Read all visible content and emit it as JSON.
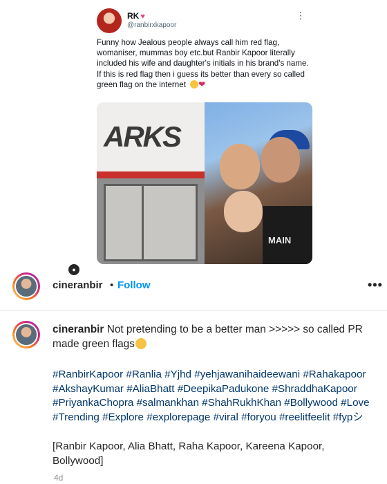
{
  "tweet": {
    "name": "RK",
    "handle": "@ranbirxkapoor",
    "more": "⋮",
    "text": "Funny how Jealous people always call him red flag, womaniser, mummas boy etc.but Ranbir Kapoor literally included his wife and daughter's initials in his brand's name. If this is red flag then i guess its better than every so called green flag on the internet",
    "heart": "❤",
    "media": {
      "store_logo": "ARKS",
      "shirt_text": "MAIN"
    }
  },
  "post": {
    "username": "cineranbir",
    "separator": "•",
    "follow_label": "Follow",
    "more": "•••",
    "user_badge": "●"
  },
  "caption": {
    "username": "cineranbir",
    "text": "Not pretending to be a better man >>>>> so called PR made green flags",
    "hashtags": [
      "#RanbirKapoor",
      "#Ranlia",
      "#Yjhd",
      "#yehjawanihaideewani",
      "#Rahakapoor",
      "#AkshayKumar",
      "#AliaBhatt",
      "#DeepikaPadukone",
      "#ShraddhaKapoor",
      "#PriyankaChopra",
      "#salmankhan",
      "#ShahRukhKhan",
      "#Bollywood",
      "#Love",
      "#Trending",
      "#Explore",
      "#explorepage",
      "#viral",
      "#foryou",
      "#reelitfeelit",
      "#fypシ"
    ],
    "names": "[Ranbir Kapoor, Alia Bhatt, Raha Kapoor, Kareena Kapoor, Bollywood]",
    "time": "4d"
  }
}
